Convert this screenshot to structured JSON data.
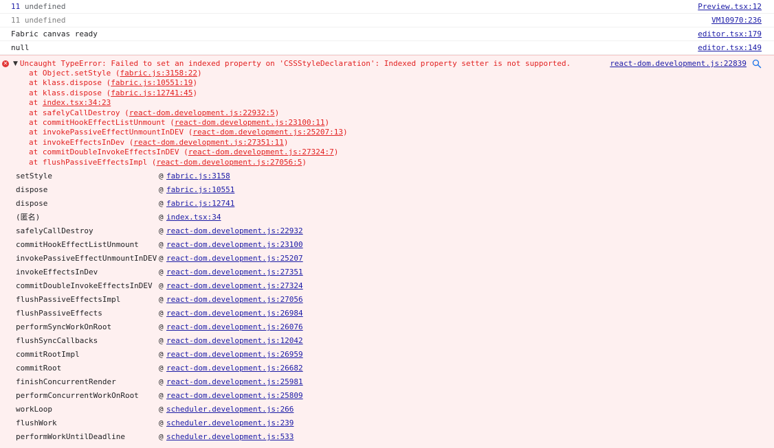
{
  "logs": [
    {
      "count": "11",
      "message": "undefined",
      "source": "Preview.tsx:12"
    },
    {
      "count": "11",
      "message": "undefined",
      "source": "VM10970:236"
    },
    {
      "message": "Fabric canvas ready",
      "source": "editor.tsx:179"
    },
    {
      "message": "null",
      "source": "editor.tsx:149"
    }
  ],
  "error": {
    "icon": "error-circle-icon",
    "message": "Uncaught TypeError: Failed to set an indexed property on 'CSSStyleDeclaration': Indexed property setter is not supported.",
    "source": "react-dom.development.js:22839",
    "stack": [
      {
        "prefix": "at Object.setStyle (",
        "link": "fabric.js:3158:22",
        "suffix": ")"
      },
      {
        "prefix": "at klass.dispose (",
        "link": "fabric.js:10551:19",
        "suffix": ")"
      },
      {
        "prefix": "at klass.dispose (",
        "link": "fabric.js:12741:45",
        "suffix": ")"
      },
      {
        "prefix": "at ",
        "link": "index.tsx:34:23",
        "suffix": ""
      },
      {
        "prefix": "at safelyCallDestroy (",
        "link": "react-dom.development.js:22932:5",
        "suffix": ")"
      },
      {
        "prefix": "at commitHookEffectListUnmount (",
        "link": "react-dom.development.js:23100:11",
        "suffix": ")"
      },
      {
        "prefix": "at invokePassiveEffectUnmountInDEV (",
        "link": "react-dom.development.js:25207:13",
        "suffix": ")"
      },
      {
        "prefix": "at invokeEffectsInDev (",
        "link": "react-dom.development.js:27351:11",
        "suffix": ")"
      },
      {
        "prefix": "at commitDoubleInvokeEffectsInDEV (",
        "link": "react-dom.development.js:27324:7",
        "suffix": ")"
      },
      {
        "prefix": "at flushPassiveEffectsImpl (",
        "link": "react-dom.development.js:27056:5",
        "suffix": ")"
      }
    ],
    "frames": [
      {
        "fn": "setStyle",
        "link": "fabric.js:3158"
      },
      {
        "fn": "dispose",
        "link": "fabric.js:10551"
      },
      {
        "fn": "dispose",
        "link": "fabric.js:12741"
      },
      {
        "fn": "(匿名)",
        "link": "index.tsx:34"
      },
      {
        "fn": "safelyCallDestroy",
        "link": "react-dom.development.js:22932"
      },
      {
        "fn": "commitHookEffectListUnmount",
        "link": "react-dom.development.js:23100"
      },
      {
        "fn": "invokePassiveEffectUnmountInDEV",
        "link": "react-dom.development.js:25207"
      },
      {
        "fn": "invokeEffectsInDev",
        "link": "react-dom.development.js:27351"
      },
      {
        "fn": "commitDoubleInvokeEffectsInDEV",
        "link": "react-dom.development.js:27324"
      },
      {
        "fn": "flushPassiveEffectsImpl",
        "link": "react-dom.development.js:27056"
      },
      {
        "fn": "flushPassiveEffects",
        "link": "react-dom.development.js:26984"
      },
      {
        "fn": "performSyncWorkOnRoot",
        "link": "react-dom.development.js:26076"
      },
      {
        "fn": "flushSyncCallbacks",
        "link": "react-dom.development.js:12042"
      },
      {
        "fn": "commitRootImpl",
        "link": "react-dom.development.js:26959"
      },
      {
        "fn": "commitRoot",
        "link": "react-dom.development.js:26682"
      },
      {
        "fn": "finishConcurrentRender",
        "link": "react-dom.development.js:25981"
      },
      {
        "fn": "performConcurrentWorkOnRoot",
        "link": "react-dom.development.js:25809"
      },
      {
        "fn": "workLoop",
        "link": "scheduler.development.js:266"
      },
      {
        "fn": "flushWork",
        "link": "scheduler.development.js:239"
      },
      {
        "fn": "performWorkUntilDeadline",
        "link": "scheduler.development.js:533"
      }
    ],
    "at_symbol": "@"
  },
  "colors": {
    "error_text": "#e22121",
    "error_bg": "#fef0f0",
    "link": "#1a1aa6"
  }
}
